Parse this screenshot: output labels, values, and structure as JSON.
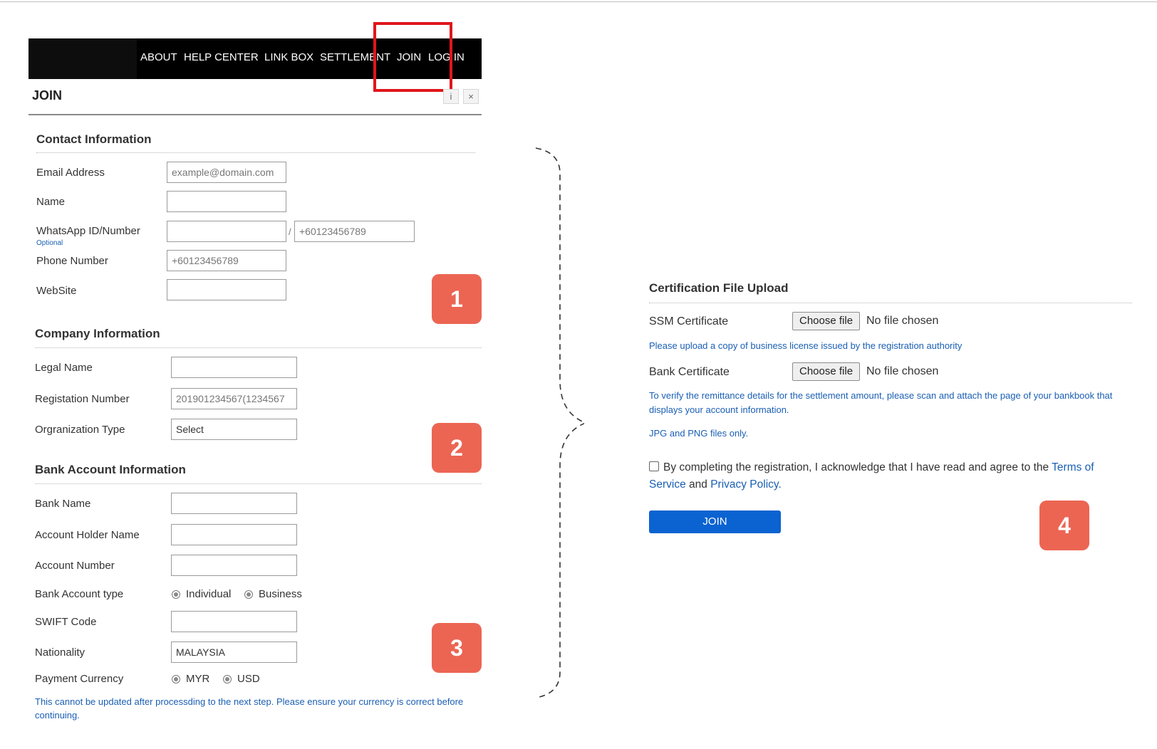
{
  "nav": {
    "items": [
      "ABOUT",
      "HELP CENTER",
      "LINK BOX",
      "SETTLEMENT",
      "JOIN",
      "LOG IN"
    ]
  },
  "header": {
    "title": "JOIN",
    "info_label": "i",
    "close_label": "×"
  },
  "contact": {
    "title": "Contact Information",
    "email_label": "Email Address",
    "email_placeholder": "example@domain.com",
    "name_label": "Name",
    "whatsapp_label": "WhatsApp ID/Number",
    "whatsapp_optional": "Optional",
    "whatsapp_separator": "/",
    "whatsapp_placeholder": "+60123456789",
    "phone_label": "Phone Number",
    "phone_placeholder": "+60123456789",
    "website_label": "WebSite"
  },
  "company": {
    "title": "Company Information",
    "legal_label": "Legal Name",
    "reg_label": "Registation Number",
    "reg_placeholder": "201901234567(1234567",
    "org_label": "Orgranization Type",
    "org_value": "Select"
  },
  "bank": {
    "title": "Bank Account Information",
    "bank_name_label": "Bank Name",
    "holder_label": "Account Holder Name",
    "number_label": "Account Number",
    "type_label": "Bank Account type",
    "type_options": [
      "Individual",
      "Business"
    ],
    "swift_label": "SWIFT Code",
    "nationality_label": "Nationality",
    "nationality_value": "MALAYSIA",
    "currency_label": "Payment Currency",
    "currency_options": [
      "MYR",
      "USD"
    ],
    "note": "This cannot be updated after processding to the next step. Please ensure your currency is correct before continuing."
  },
  "cert": {
    "title": "Certification File Upload",
    "ssm_label": "SSM Certificate",
    "choose_file": "Choose file",
    "no_file": "No file chosen",
    "ssm_note": "Please upload a copy of business license issued by the registration authority",
    "bank_label": "Bank Certificate",
    "bank_note": "To verify the remittance details for the settlement amount, please scan and attach the page of your bankbook that displays your account information.",
    "format_note": "JPG and PNG files only.",
    "agree_text": "By completing the registration, I acknowledge that I have read and agree to the",
    "terms": "Terms of Service",
    "and": "and",
    "privacy": "Privacy Policy.",
    "join_button": "JOIN"
  },
  "badges": [
    "1",
    "2",
    "3",
    "4"
  ],
  "colors": {
    "highlight": "#e0161b",
    "badge": "#ec6553",
    "link": "#1a5fb4",
    "primary_button": "#0b63d1",
    "navbar": "#000000"
  }
}
